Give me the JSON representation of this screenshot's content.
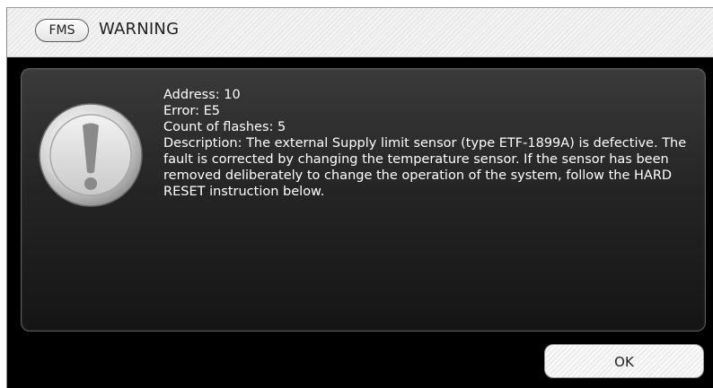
{
  "window": {
    "badge": "FMS",
    "title": "WARNING"
  },
  "message": {
    "address": "Address: 10",
    "error": "Error: E5",
    "flashes": "Count of flashes: 5",
    "description": "Description: The external Supply limit sensor (type ETF-1899A) is defective. The fault is corrected by changing the temperature sensor. If the sensor has been removed deliberately to change the operation of the system, follow the HARD RESET instruction below."
  },
  "buttons": {
    "ok_label": "OK"
  },
  "icons": {
    "warning": "exclamation-icon"
  },
  "colors": {
    "dialog_background": "#000000",
    "panel_background": "#2a2a2a",
    "message_text": "#ffffff",
    "title_text": "#222222"
  }
}
